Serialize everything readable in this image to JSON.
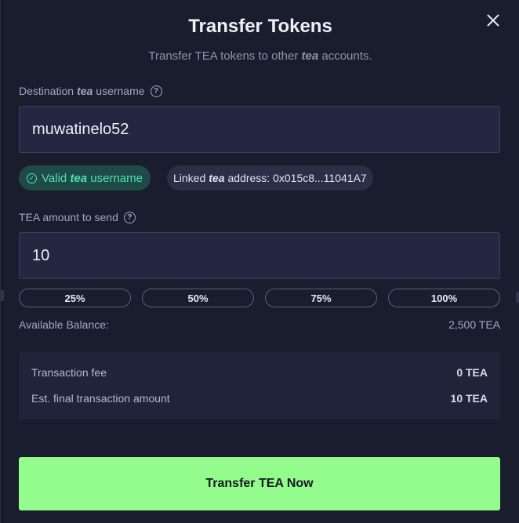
{
  "header": {
    "title": "Transfer Tokens",
    "subtitle_pre": "Transfer TEA tokens to other ",
    "subtitle_em": "tea",
    "subtitle_post": " accounts."
  },
  "destination": {
    "label_pre": "Destination ",
    "label_em": "tea",
    "label_post": " username",
    "value": "muwatinelo52",
    "valid_pre": "Valid ",
    "valid_em": "tea",
    "valid_post": " username",
    "linked_pre": "Linked",
    "linked_em": "tea",
    "linked_post": "address: 0x015c8...11041A7"
  },
  "amount": {
    "label": "TEA amount to send",
    "value": "10",
    "percent_buttons": [
      "25%",
      "50%",
      "75%",
      "100%"
    ],
    "balance_label": "Available Balance:",
    "balance_value": "2,500 TEA"
  },
  "summary": {
    "fee_label": "Transaction fee",
    "fee_value": "0 TEA",
    "final_label": "Est. final transaction amount",
    "final_value": "10 TEA"
  },
  "cta": {
    "label": "Transfer TEA Now"
  },
  "icons": {
    "close": "close-icon",
    "help": "help-icon",
    "check": "check-circle-icon"
  },
  "colors": {
    "accent": "#94fc8c",
    "valid": "#4fe0b5",
    "background": "#1a1d2e"
  }
}
